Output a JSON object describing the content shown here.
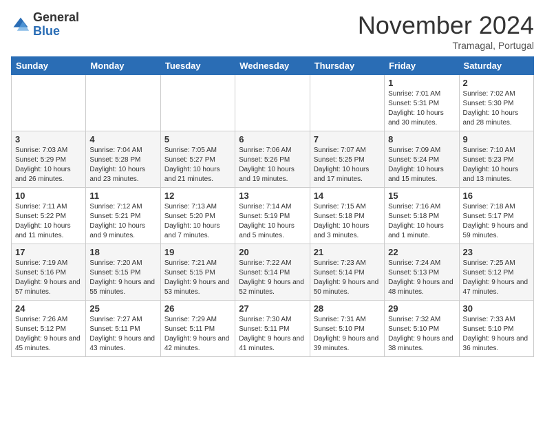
{
  "header": {
    "logo_general": "General",
    "logo_blue": "Blue",
    "month_title": "November 2024",
    "location": "Tramagal, Portugal"
  },
  "weekdays": [
    "Sunday",
    "Monday",
    "Tuesday",
    "Wednesday",
    "Thursday",
    "Friday",
    "Saturday"
  ],
  "weeks": [
    [
      {
        "day": "",
        "info": ""
      },
      {
        "day": "",
        "info": ""
      },
      {
        "day": "",
        "info": ""
      },
      {
        "day": "",
        "info": ""
      },
      {
        "day": "",
        "info": ""
      },
      {
        "day": "1",
        "info": "Sunrise: 7:01 AM\nSunset: 5:31 PM\nDaylight: 10 hours and 30 minutes."
      },
      {
        "day": "2",
        "info": "Sunrise: 7:02 AM\nSunset: 5:30 PM\nDaylight: 10 hours and 28 minutes."
      }
    ],
    [
      {
        "day": "3",
        "info": "Sunrise: 7:03 AM\nSunset: 5:29 PM\nDaylight: 10 hours and 26 minutes."
      },
      {
        "day": "4",
        "info": "Sunrise: 7:04 AM\nSunset: 5:28 PM\nDaylight: 10 hours and 23 minutes."
      },
      {
        "day": "5",
        "info": "Sunrise: 7:05 AM\nSunset: 5:27 PM\nDaylight: 10 hours and 21 minutes."
      },
      {
        "day": "6",
        "info": "Sunrise: 7:06 AM\nSunset: 5:26 PM\nDaylight: 10 hours and 19 minutes."
      },
      {
        "day": "7",
        "info": "Sunrise: 7:07 AM\nSunset: 5:25 PM\nDaylight: 10 hours and 17 minutes."
      },
      {
        "day": "8",
        "info": "Sunrise: 7:09 AM\nSunset: 5:24 PM\nDaylight: 10 hours and 15 minutes."
      },
      {
        "day": "9",
        "info": "Sunrise: 7:10 AM\nSunset: 5:23 PM\nDaylight: 10 hours and 13 minutes."
      }
    ],
    [
      {
        "day": "10",
        "info": "Sunrise: 7:11 AM\nSunset: 5:22 PM\nDaylight: 10 hours and 11 minutes."
      },
      {
        "day": "11",
        "info": "Sunrise: 7:12 AM\nSunset: 5:21 PM\nDaylight: 10 hours and 9 minutes."
      },
      {
        "day": "12",
        "info": "Sunrise: 7:13 AM\nSunset: 5:20 PM\nDaylight: 10 hours and 7 minutes."
      },
      {
        "day": "13",
        "info": "Sunrise: 7:14 AM\nSunset: 5:19 PM\nDaylight: 10 hours and 5 minutes."
      },
      {
        "day": "14",
        "info": "Sunrise: 7:15 AM\nSunset: 5:18 PM\nDaylight: 10 hours and 3 minutes."
      },
      {
        "day": "15",
        "info": "Sunrise: 7:16 AM\nSunset: 5:18 PM\nDaylight: 10 hours and 1 minute."
      },
      {
        "day": "16",
        "info": "Sunrise: 7:18 AM\nSunset: 5:17 PM\nDaylight: 9 hours and 59 minutes."
      }
    ],
    [
      {
        "day": "17",
        "info": "Sunrise: 7:19 AM\nSunset: 5:16 PM\nDaylight: 9 hours and 57 minutes."
      },
      {
        "day": "18",
        "info": "Sunrise: 7:20 AM\nSunset: 5:15 PM\nDaylight: 9 hours and 55 minutes."
      },
      {
        "day": "19",
        "info": "Sunrise: 7:21 AM\nSunset: 5:15 PM\nDaylight: 9 hours and 53 minutes."
      },
      {
        "day": "20",
        "info": "Sunrise: 7:22 AM\nSunset: 5:14 PM\nDaylight: 9 hours and 52 minutes."
      },
      {
        "day": "21",
        "info": "Sunrise: 7:23 AM\nSunset: 5:14 PM\nDaylight: 9 hours and 50 minutes."
      },
      {
        "day": "22",
        "info": "Sunrise: 7:24 AM\nSunset: 5:13 PM\nDaylight: 9 hours and 48 minutes."
      },
      {
        "day": "23",
        "info": "Sunrise: 7:25 AM\nSunset: 5:12 PM\nDaylight: 9 hours and 47 minutes."
      }
    ],
    [
      {
        "day": "24",
        "info": "Sunrise: 7:26 AM\nSunset: 5:12 PM\nDaylight: 9 hours and 45 minutes."
      },
      {
        "day": "25",
        "info": "Sunrise: 7:27 AM\nSunset: 5:11 PM\nDaylight: 9 hours and 43 minutes."
      },
      {
        "day": "26",
        "info": "Sunrise: 7:29 AM\nSunset: 5:11 PM\nDaylight: 9 hours and 42 minutes."
      },
      {
        "day": "27",
        "info": "Sunrise: 7:30 AM\nSunset: 5:11 PM\nDaylight: 9 hours and 41 minutes."
      },
      {
        "day": "28",
        "info": "Sunrise: 7:31 AM\nSunset: 5:10 PM\nDaylight: 9 hours and 39 minutes."
      },
      {
        "day": "29",
        "info": "Sunrise: 7:32 AM\nSunset: 5:10 PM\nDaylight: 9 hours and 38 minutes."
      },
      {
        "day": "30",
        "info": "Sunrise: 7:33 AM\nSunset: 5:10 PM\nDaylight: 9 hours and 36 minutes."
      }
    ]
  ]
}
